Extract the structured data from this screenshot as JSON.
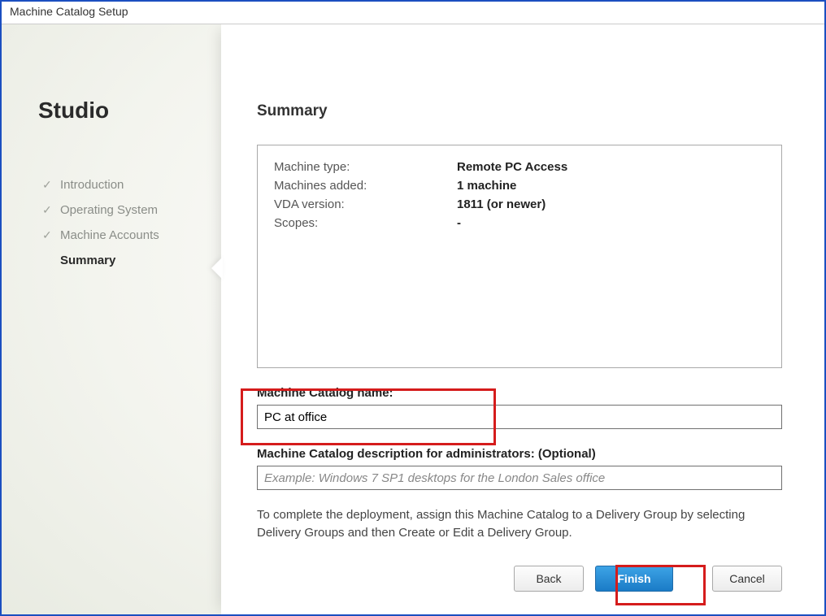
{
  "window": {
    "title": "Machine Catalog Setup"
  },
  "sidebar": {
    "app_title": "Studio",
    "steps": [
      {
        "label": "Introduction",
        "done": true
      },
      {
        "label": "Operating System",
        "done": true
      },
      {
        "label": "Machine Accounts",
        "done": true
      },
      {
        "label": "Summary",
        "done": false,
        "current": true
      }
    ]
  },
  "main": {
    "heading": "Summary",
    "summary": [
      {
        "label": "Machine type:",
        "value": "Remote PC Access"
      },
      {
        "label": "Machines added:",
        "value": "1 machine"
      },
      {
        "label": "VDA version:",
        "value": "1811 (or newer)"
      },
      {
        "label": "Scopes:",
        "value": "-"
      }
    ],
    "name_field": {
      "label": "Machine Catalog name:",
      "value": "PC at office"
    },
    "desc_field": {
      "label": "Machine Catalog description for administrators: (Optional)",
      "placeholder": "Example: Windows 7 SP1 desktops for the London Sales office",
      "value": ""
    },
    "hint": "To complete the deployment, assign this Machine Catalog to a Delivery Group by selecting Delivery Groups and then Create or Edit a Delivery Group."
  },
  "buttons": {
    "back": "Back",
    "finish": "Finish",
    "cancel": "Cancel"
  },
  "highlights": {
    "name": true,
    "finish": true
  }
}
